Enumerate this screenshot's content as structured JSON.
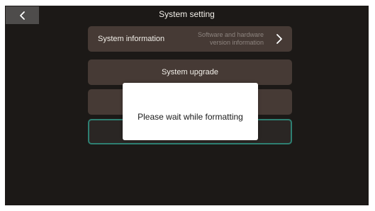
{
  "header": {
    "title": "System setting",
    "back_icon": "chevron-left-icon"
  },
  "menu": {
    "system_information": {
      "label": "System information",
      "description_line1": "Software and hardware",
      "description_line2": "version information",
      "icon": "chevron-right-icon"
    },
    "system_upgrade": {
      "label": "System upgrade"
    }
  },
  "dialog": {
    "message": "Please wait while formatting"
  },
  "colors": {
    "background": "#1c1917",
    "row": "#463a35",
    "selected_border": "#2e7f72",
    "text": "#f2efe9",
    "muted_text": "#8d847f"
  }
}
